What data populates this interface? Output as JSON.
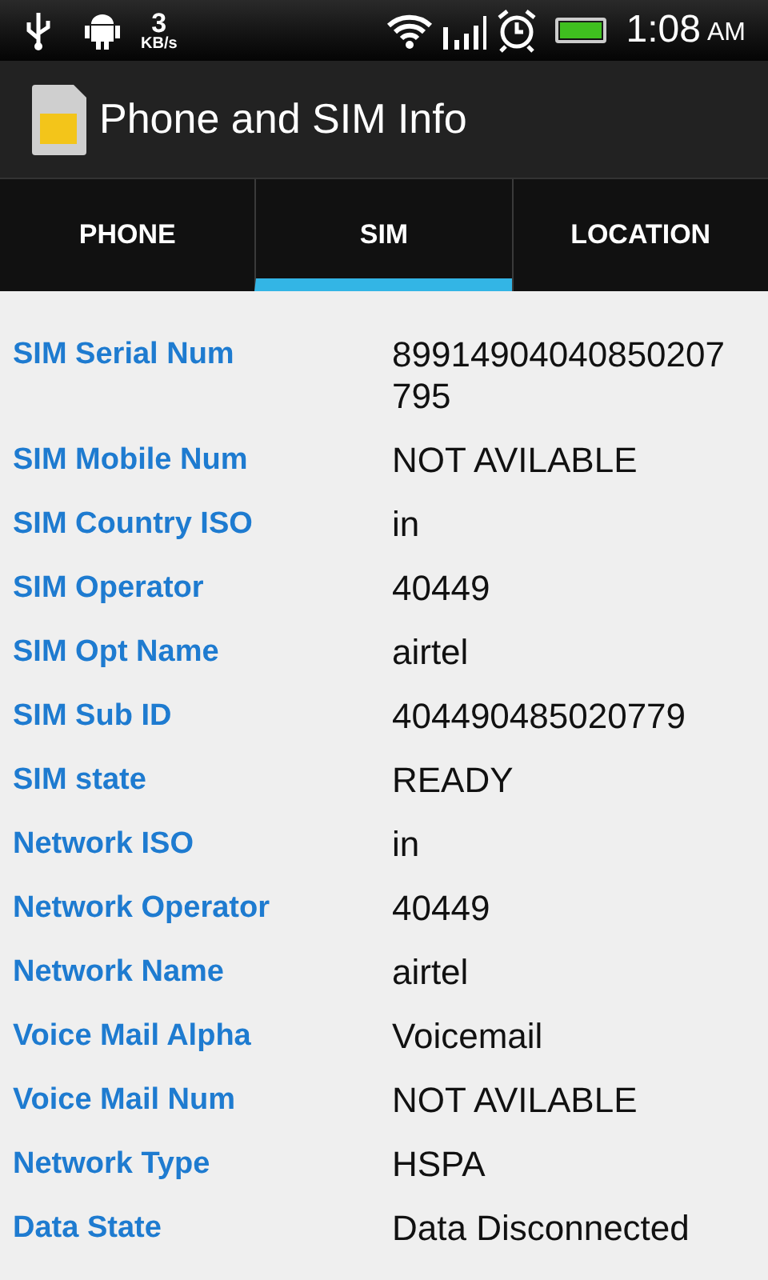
{
  "status_bar": {
    "speed": "3",
    "speed_unit": "KB/s",
    "time": "1:08",
    "meridiem": "AM"
  },
  "app_bar": {
    "title": "Phone and SIM Info"
  },
  "tabs": [
    {
      "label": "PHONE",
      "selected": false
    },
    {
      "label": "SIM",
      "selected": true
    },
    {
      "label": "LOCATION",
      "selected": false
    }
  ],
  "rows": [
    {
      "label": "SIM Serial Num",
      "value": "89914904040850207795"
    },
    {
      "label": "SIM Mobile Num",
      "value": "NOT AVILABLE"
    },
    {
      "label": "SIM Country ISO",
      "value": "in"
    },
    {
      "label": "SIM Operator",
      "value": "40449"
    },
    {
      "label": "SIM Opt Name",
      "value": "airtel"
    },
    {
      "label": "SIM Sub ID",
      "value": "404490485020779"
    },
    {
      "label": "SIM state",
      "value": "READY"
    },
    {
      "label": "Network ISO",
      "value": "in"
    },
    {
      "label": "Network Operator",
      "value": "40449"
    },
    {
      "label": "Network Name",
      "value": "airtel"
    },
    {
      "label": "Voice Mail Alpha",
      "value": "Voicemail"
    },
    {
      "label": "Voice Mail Num",
      "value": "NOT AVILABLE"
    },
    {
      "label": "Network Type",
      "value": "HSPA"
    },
    {
      "label": "Data State",
      "value": "Data Disconnected"
    }
  ]
}
